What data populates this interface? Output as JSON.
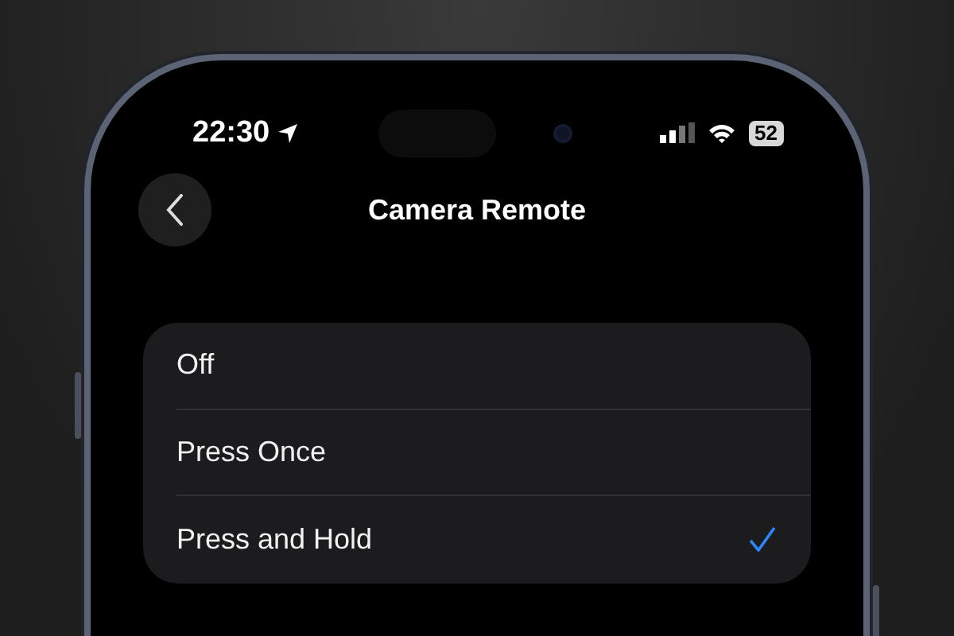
{
  "status_bar": {
    "time": "22:30",
    "battery": "52"
  },
  "nav": {
    "title": "Camera Remote"
  },
  "options": [
    {
      "label": "Off",
      "selected": false
    },
    {
      "label": "Press Once",
      "selected": false
    },
    {
      "label": "Press and Hold",
      "selected": true
    }
  ]
}
